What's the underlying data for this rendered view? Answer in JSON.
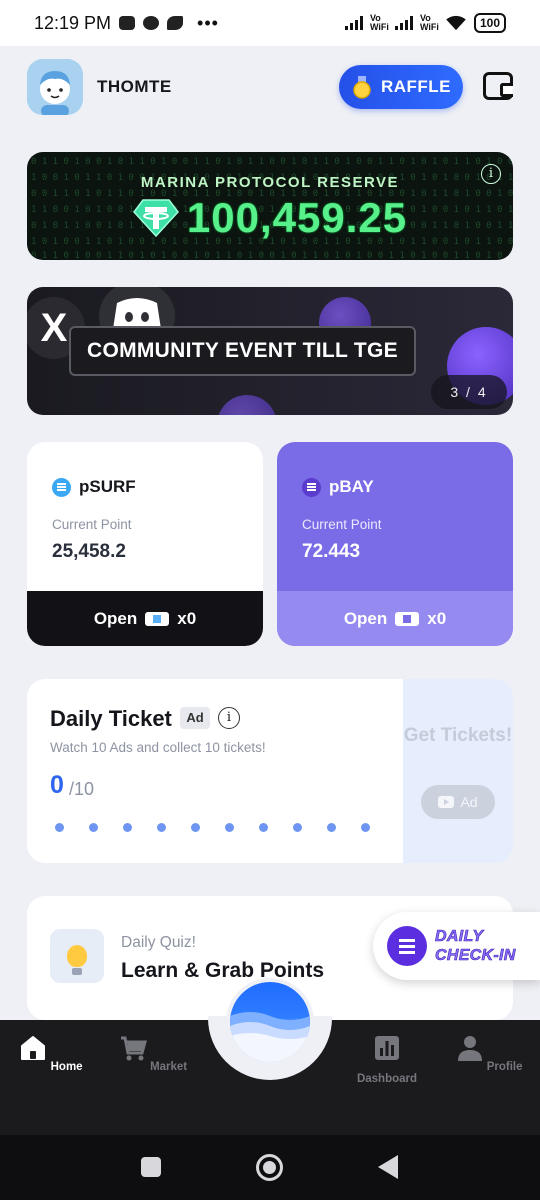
{
  "status_bar": {
    "time": "12:19 PM",
    "dots": "•••",
    "vo_wifi_1": "Vo WiFi",
    "vo_wifi_2": "Vo WiFi",
    "battery": "100"
  },
  "header": {
    "username": "THOMTE",
    "raffle_label": "RAFFLE"
  },
  "reserve": {
    "label": "MARINA PROTOCOL RESERVE",
    "value": "100,459.25",
    "info": "i"
  },
  "carousel": {
    "title": "COMMUNITY EVENT TILL TGE",
    "x_mark": "X",
    "pager": "3 / 4"
  },
  "point_cards": [
    {
      "token": "pSURF",
      "sublabel": "Current Point",
      "value": "25,458.2",
      "open_label": "Open",
      "count": "x0"
    },
    {
      "token": "pBAY",
      "sublabel": "Current Point",
      "value": "72.443",
      "open_label": "Open",
      "count": "x0"
    }
  ],
  "daily_ticket": {
    "title": "Daily Ticket",
    "ad_badge": "Ad",
    "info": "i",
    "description": "Watch 10 Ads and collect 10 tickets!",
    "count": "0",
    "max": "/10",
    "progress": 0,
    "total": 10,
    "get_tickets": "Get Tickets!",
    "ad_button": "Ad"
  },
  "daily_quiz": {
    "sublabel": "Daily Quiz!",
    "title": "Learn & Grab Points"
  },
  "check_in": {
    "line1": "DAILY",
    "line2": "CHECK-IN"
  },
  "nav": {
    "home": "Home",
    "market": "Market",
    "dashboard": "Dashboard",
    "profile": "Profile",
    "active": "home"
  },
  "colors": {
    "accent_blue": "#2f66f0",
    "bay_purple": "#7a6ce6",
    "reserve_green": "#57f08a"
  }
}
